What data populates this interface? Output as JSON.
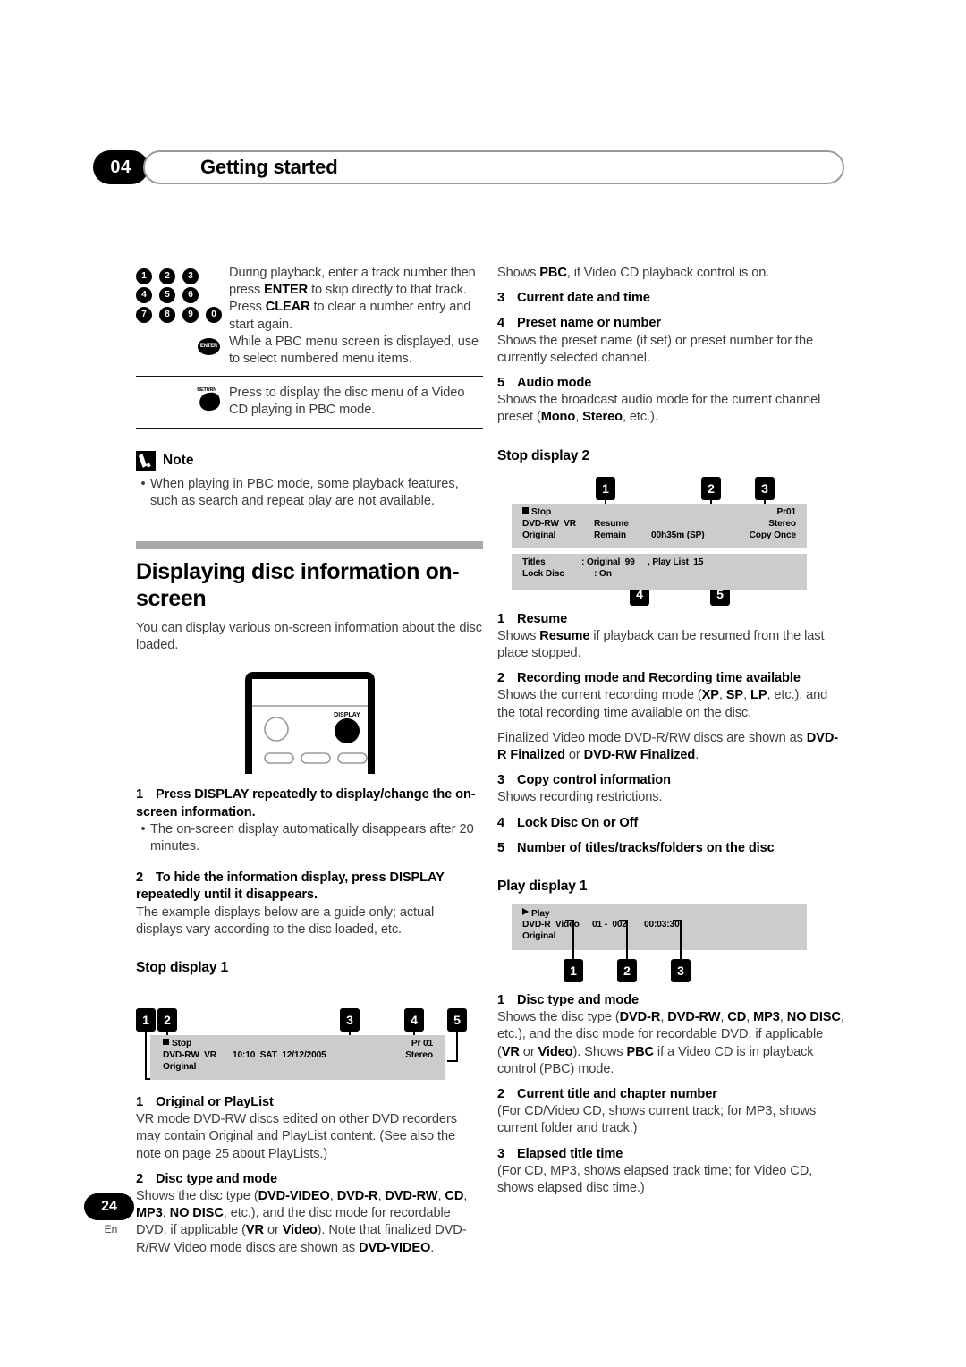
{
  "header": {
    "chapter_number": "04",
    "chapter_title": "Getting started"
  },
  "footer": {
    "page_number": "24",
    "language": "En"
  },
  "left_column": {
    "key_table": {
      "numpad_keys": [
        "1",
        "2",
        "3",
        "4",
        "5",
        "6",
        "7",
        "8",
        "9",
        "0"
      ],
      "enter_label": "ENTER",
      "return_label": "RETURN",
      "numpad_desc_line1_a": "During playback, enter a track number then press ",
      "numpad_desc_line1_b": "ENTER",
      "numpad_desc_line1_c": " to skip directly to that track.",
      "numpad_desc_line2_a": "Press ",
      "numpad_desc_line2_b": "CLEAR",
      "numpad_desc_line2_c": " to clear a number entry and start again.",
      "enter_desc": "While a PBC menu screen is displayed, use to select numbered menu items.",
      "return_desc": "Press to display the disc menu of a Video CD playing in PBC mode."
    },
    "note": {
      "title": "Note",
      "bullets": [
        "When playing in PBC mode, some playback features, such as search and repeat play are not available."
      ]
    },
    "section": {
      "heading": "Displaying disc information on-screen",
      "intro": "You can display various on-screen information about the disc loaded."
    },
    "remote": {
      "display_button_label": "DISPLAY"
    },
    "steps": [
      {
        "number": "1",
        "title": "Press DISPLAY repeatedly to display/change the on-screen information.",
        "bullets": [
          "The on-screen display automatically disappears after 20 minutes."
        ]
      },
      {
        "number": "2",
        "title": "To hide the information display, press DISPLAY repeatedly until it disappears.",
        "body": "The example displays below are a guide only; actual displays vary according to the disc loaded, etc."
      }
    ],
    "stop_display_1": {
      "heading": "Stop display 1",
      "callouts": [
        "1",
        "2",
        "3",
        "4",
        "5"
      ],
      "osd": {
        "status": "Stop",
        "disc_type": "DVD-RW  VR",
        "mode": "Original",
        "datetime": "10:10  SAT  12/12/2005",
        "preset": "Pr 01",
        "audio": "Stereo"
      }
    },
    "items": [
      {
        "number": "1",
        "title": "Original or PlayList",
        "body": "VR mode DVD-RW discs edited on other DVD recorders may contain Original and PlayList content. (See also the note on page 25 about PlayLists.)"
      },
      {
        "number": "2",
        "title": "Disc type and mode",
        "body_html": "Shows the disc type (<b>DVD-VIDEO</b>, <b>DVD-R</b>, <b>DVD-RW</b>, <b>CD</b>, <b>MP3</b>, <b>NO DISC</b>, etc.), and the disc mode for recordable DVD, if applicable (<b>VR</b> or <b>Video</b>). Note that finalized DVD-R/RW Video mode discs are shown as <b>DVD-VIDEO</b>."
      }
    ]
  },
  "right_column": {
    "pbc_note_html": "Shows <b>PBC</b>, if Video CD playback control is on.",
    "stop1_items": [
      {
        "number": "3",
        "title": "Current date and time",
        "body": ""
      },
      {
        "number": "4",
        "title": "Preset name or number",
        "body": "Shows the preset name (if set) or preset number for the currently selected channel."
      },
      {
        "number": "5",
        "title": "Audio mode",
        "body_html": "Shows the broadcast audio mode for the current channel preset (<b>Mono</b>, <b>Stereo</b>, etc.)."
      }
    ],
    "stop_display_2": {
      "heading": "Stop display 2",
      "callouts": [
        "1",
        "2",
        "3",
        "4",
        "5"
      ],
      "osd_top": {
        "status": "Stop",
        "disc_type": "DVD-RW  VR",
        "mode": "Original",
        "resume": "Resume",
        "remain_label": "Remain",
        "remain_value": "00h35m (SP)",
        "preset": "Pr01",
        "audio": "Stereo",
        "copy": "Copy Once"
      },
      "osd_bottom": {
        "titles_label": "Titles",
        "titles_value": ": Original  99",
        "playlist_value": ", Play List  15",
        "lock_label": "Lock Disc",
        "lock_value": ": On"
      }
    },
    "stop2_items": [
      {
        "number": "1",
        "title": "Resume",
        "body_html": "Shows <b>Resume</b> if playback can be resumed from the last place stopped."
      },
      {
        "number": "2",
        "title": "Recording mode and Recording time available",
        "body_html": "Shows the current recording mode (<b>XP</b>, <b>SP</b>, <b>LP</b>, etc.), and the total recording time available on the disc.",
        "body2_html": "Finalized Video mode DVD-R/RW discs are shown as <b>DVD-R Finalized</b> or <b>DVD-RW Finalized</b>."
      },
      {
        "number": "3",
        "title": "Copy control information",
        "body": "Shows recording restrictions."
      },
      {
        "number": "4",
        "title": "Lock Disc On or Off",
        "body": ""
      },
      {
        "number": "5",
        "title": "Number of titles/tracks/folders on the disc",
        "body": ""
      }
    ],
    "play_display_1": {
      "heading": "Play display 1",
      "callouts": [
        "1",
        "2",
        "3"
      ],
      "osd": {
        "status": "Play",
        "disc_type": "DVD-R  Video",
        "mode": "Original",
        "title_chapter": "01 -  002",
        "elapsed": "00:03:30"
      }
    },
    "play1_items": [
      {
        "number": "1",
        "title": "Disc type and mode",
        "body_html": "Shows the disc type (<b>DVD-R</b>, <b>DVD-RW</b>, <b>CD</b>, <b>MP3</b>, <b>NO DISC</b>, etc.), and the disc mode for recordable DVD, if applicable (<b>VR</b> or <b>Video</b>).  Shows <b>PBC</b> if a Video CD is in playback control (PBC) mode."
      },
      {
        "number": "2",
        "title": "Current title and chapter number",
        "body": "(For CD/Video CD, shows current track; for MP3, shows current folder and track.)"
      },
      {
        "number": "3",
        "title": "Elapsed title time",
        "body": "(For CD, MP3, shows elapsed track time; for Video CD, shows elapsed disc time.)"
      }
    ]
  },
  "colors": {
    "osd_panel": "#cccccc",
    "section_bar": "#a8a8a8",
    "body_text": "#3d3d3d"
  }
}
